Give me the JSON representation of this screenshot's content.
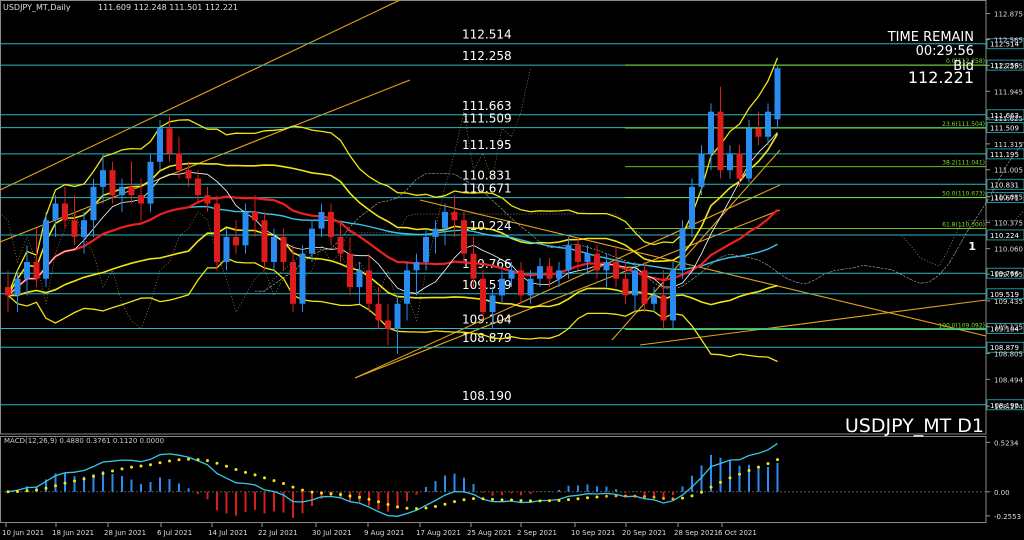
{
  "header": {
    "symbol_tf": "USDJPY_MT,Daily",
    "ohlc": "111.609 112.248 111.501 112.221"
  },
  "overlay": {
    "time_remain_label": "TIME REMAIN",
    "time_remain_value": "00:29:56",
    "bid_label": "Bid",
    "bid_value": "112.221",
    "symbol_period": "USDJPY_MT D1",
    "marker": "1"
  },
  "colors": {
    "bg": "#000000",
    "bull": "#2a8cf0",
    "bear": "#dd1c1c",
    "level_line": "#2ab7c3",
    "fib_line": "#7ddc1c",
    "bollinger": "#f2e512",
    "ma_red": "#ee1f1f",
    "ma_cyan": "#37c6e6",
    "trend": "#e6a31a",
    "macd_line": "#37c6e6",
    "macd_signal": "#f2e512"
  },
  "chart_data": {
    "type": "candlestick",
    "ylim": [
      107.84,
      112.99
    ],
    "y_ticks": [
      "112.875",
      "112.565",
      "112.255",
      "111.945",
      "111.625",
      "111.315",
      "111.005",
      "110.685",
      "110.375",
      "110.060",
      "109.755",
      "109.435",
      "109.125",
      "108.805",
      "108.494",
      "108.174"
    ],
    "x_tick_labels": [
      "10 Jun 2021",
      "18 Jun 2021",
      "28 Jun 2021",
      "6 Jul 2021",
      "14 Jul 2021",
      "22 Jul 2021",
      "30 Jul 2021",
      "9 Aug 2021",
      "17 Aug 2021",
      "25 Aug 2021",
      "2 Sep 2021",
      "10 Sep 2021",
      "20 Sep 2021",
      "28 Sep 2021",
      "6 Oct 2021"
    ],
    "levels": [
      {
        "label": "112.514",
        "value": 112.514,
        "tag": "112.514"
      },
      {
        "label": "112.258",
        "value": 112.258,
        "tag": "112.258"
      },
      {
        "label": "111.663",
        "value": 111.663,
        "tag": "111.663"
      },
      {
        "label": "111.509",
        "value": 111.509,
        "tag": "111.509"
      },
      {
        "label": "111.195",
        "value": 111.195,
        "tag": "111.195"
      },
      {
        "label": "110.831",
        "value": 110.831,
        "tag": "110.831"
      },
      {
        "label": "110.671",
        "value": 110.671,
        "tag": "110.671"
      },
      {
        "label": "110.224",
        "value": 110.224,
        "tag": "110.224"
      },
      {
        "label": "109.766",
        "value": 109.766,
        "tag": "109.766"
      },
      {
        "label": "109.519",
        "value": 109.519,
        "tag": "109.519"
      },
      {
        "label": "109.104",
        "value": 109.104,
        "tag": "109.104"
      },
      {
        "label": "108.879",
        "value": 108.879,
        "tag": "108.879"
      },
      {
        "label": "108.190",
        "value": 108.19,
        "tag": "108.190"
      }
    ],
    "fib_levels": [
      {
        "label": "0.0(112.258)",
        "value": 112.258
      },
      {
        "label": "23.6(111.504)",
        "value": 111.504
      },
      {
        "label": "38.2(111.041)",
        "value": 111.041
      },
      {
        "label": "50.0(110.673)",
        "value": 110.673
      },
      {
        "label": "61.8(110.300)",
        "value": 110.3
      },
      {
        "label": "100.0(109.092)",
        "value": 109.092
      }
    ],
    "candles": [
      [
        109.6,
        109.8,
        109.3,
        109.5
      ],
      [
        109.5,
        109.8,
        109.3,
        109.7
      ],
      [
        109.7,
        110.1,
        109.5,
        109.9
      ],
      [
        109.9,
        110.3,
        109.6,
        109.7
      ],
      [
        109.7,
        110.5,
        109.6,
        110.4
      ],
      [
        110.4,
        110.7,
        110.2,
        110.6
      ],
      [
        110.6,
        110.8,
        110.3,
        110.4
      ],
      [
        110.4,
        110.7,
        110.1,
        110.2
      ],
      [
        110.2,
        110.5,
        110.0,
        110.4
      ],
      [
        110.4,
        110.9,
        110.2,
        110.8
      ],
      [
        110.8,
        111.2,
        110.6,
        111.0
      ],
      [
        111.0,
        111.1,
        110.6,
        110.7
      ],
      [
        110.7,
        110.9,
        110.5,
        110.8
      ],
      [
        110.8,
        111.1,
        110.6,
        110.7
      ],
      [
        110.7,
        110.9,
        110.4,
        110.6
      ],
      [
        110.6,
        111.2,
        110.5,
        111.1
      ],
      [
        111.1,
        111.6,
        111.0,
        111.5
      ],
      [
        111.5,
        111.65,
        111.1,
        111.2
      ],
      [
        111.2,
        111.4,
        110.9,
        111.0
      ],
      [
        111.0,
        111.1,
        110.8,
        110.9
      ],
      [
        110.9,
        111.0,
        110.6,
        110.7
      ],
      [
        110.7,
        110.8,
        110.5,
        110.6
      ],
      [
        110.6,
        110.7,
        109.8,
        109.9
      ],
      [
        109.9,
        110.3,
        109.8,
        110.2
      ],
      [
        110.2,
        110.4,
        110.0,
        110.1
      ],
      [
        110.1,
        110.6,
        110.0,
        110.5
      ],
      [
        110.5,
        110.7,
        110.2,
        110.4
      ],
      [
        110.4,
        110.5,
        109.8,
        109.9
      ],
      [
        109.9,
        110.3,
        109.8,
        110.2
      ],
      [
        110.2,
        110.3,
        109.8,
        109.9
      ],
      [
        109.9,
        110.1,
        109.3,
        109.4
      ],
      [
        109.4,
        110.1,
        109.3,
        110.0
      ],
      [
        110.0,
        110.4,
        109.9,
        110.3
      ],
      [
        110.3,
        110.6,
        110.2,
        110.5
      ],
      [
        110.5,
        110.6,
        110.1,
        110.2
      ],
      [
        110.2,
        110.4,
        109.9,
        110.0
      ],
      [
        110.0,
        110.2,
        109.5,
        109.6
      ],
      [
        109.6,
        109.9,
        109.4,
        109.8
      ],
      [
        109.8,
        110.0,
        109.3,
        109.4
      ],
      [
        109.4,
        109.6,
        109.1,
        109.2
      ],
      [
        109.2,
        109.4,
        108.9,
        109.1
      ],
      [
        109.1,
        109.5,
        108.8,
        109.4
      ],
      [
        109.4,
        109.9,
        109.2,
        109.8
      ],
      [
        109.8,
        110.0,
        109.5,
        109.9
      ],
      [
        109.9,
        110.3,
        109.8,
        110.2
      ],
      [
        110.2,
        110.4,
        110.0,
        110.3
      ],
      [
        110.3,
        110.6,
        110.1,
        110.5
      ],
      [
        110.5,
        110.7,
        110.2,
        110.4
      ],
      [
        110.4,
        110.5,
        109.9,
        110.0
      ],
      [
        110.0,
        110.2,
        109.6,
        109.7
      ],
      [
        109.7,
        109.8,
        109.2,
        109.3
      ],
      [
        109.3,
        109.6,
        109.1,
        109.5
      ],
      [
        109.5,
        109.8,
        109.4,
        109.7
      ],
      [
        109.7,
        109.9,
        109.6,
        109.8
      ],
      [
        109.8,
        109.9,
        109.4,
        109.5
      ],
      [
        109.5,
        109.8,
        109.4,
        109.7
      ],
      [
        109.7,
        109.95,
        109.6,
        109.85
      ],
      [
        109.85,
        109.95,
        109.6,
        109.7
      ],
      [
        109.7,
        109.9,
        109.6,
        109.8
      ],
      [
        109.8,
        110.2,
        109.7,
        110.1
      ],
      [
        110.1,
        110.2,
        109.8,
        109.9
      ],
      [
        109.9,
        110.1,
        109.75,
        110.0
      ],
      [
        110.0,
        110.1,
        109.7,
        109.8
      ],
      [
        109.8,
        110.0,
        109.6,
        109.9
      ],
      [
        109.9,
        110.1,
        109.6,
        109.7
      ],
      [
        109.7,
        109.9,
        109.4,
        109.5
      ],
      [
        109.5,
        109.9,
        109.3,
        109.8
      ],
      [
        109.8,
        109.9,
        109.3,
        109.4
      ],
      [
        109.4,
        109.6,
        109.3,
        109.5
      ],
      [
        109.5,
        109.8,
        109.1,
        109.2
      ],
      [
        109.2,
        109.9,
        109.1,
        109.8
      ],
      [
        109.8,
        110.4,
        109.7,
        110.3
      ],
      [
        110.3,
        110.9,
        110.2,
        110.8
      ],
      [
        110.8,
        111.3,
        110.7,
        111.2
      ],
      [
        111.2,
        111.8,
        111.0,
        111.7
      ],
      [
        111.7,
        112.0,
        110.9,
        111.0
      ],
      [
        111.0,
        111.3,
        110.9,
        111.2
      ],
      [
        111.2,
        111.3,
        110.8,
        110.9
      ],
      [
        110.9,
        111.6,
        110.85,
        111.5
      ],
      [
        111.5,
        111.7,
        111.3,
        111.4
      ],
      [
        111.4,
        111.8,
        111.3,
        111.7
      ],
      [
        111.609,
        112.248,
        111.501,
        112.221
      ]
    ],
    "macd": {
      "label": "MACD(12,26,9) 0.4880 0.3761 0.1120 0.0000",
      "ticks": [
        "0.5234",
        "0.00",
        "-0.2553"
      ],
      "ylim": [
        -0.32,
        0.58
      ]
    }
  }
}
